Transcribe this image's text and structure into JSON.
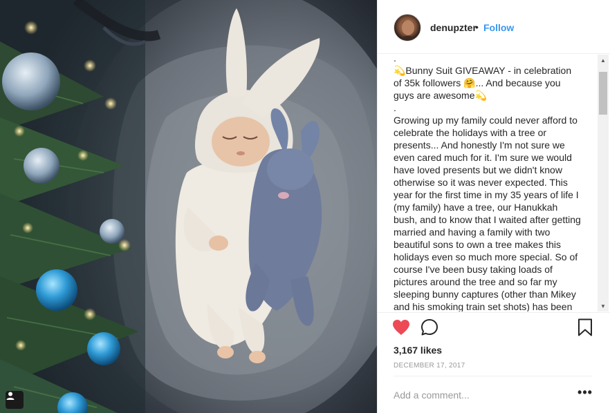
{
  "post": {
    "username": "denupzter",
    "separator": "•",
    "follow_label": "Follow",
    "caption": ".\n💫Bunny Suit GIVEAWAY - in celebration of 35k followers 🤗... And because you guys are awesome💫\n.\nGrowing up my family could never afford to celebrate the holidays with a tree or presents... And honestly I'm not sure we even cared much for it. I'm sure we would have loved presents but we didn't know otherwise so it was never expected. This year for the first time in my 35 years of life I (my family) have a tree, our Hanukkah bush, and to know that I waited after getting married and having a family with two beautiful sons to own a tree makes this holidays even so much more special. So of course I've been busy taking loads of pictures around the tree and so far my sleeping bunny captures (other than Mikey and his smoking train set shots) has been my favorite. That being said... I'm",
    "likes": "3,167 likes",
    "date": "December 17, 2017",
    "comment_placeholder": "Add a comment...",
    "more_label": "•••"
  },
  "icons": {
    "like": "heart-icon",
    "comment": "comment-bubble-icon",
    "save": "bookmark-icon",
    "tag": "user-tag-icon"
  },
  "colors": {
    "accent": "#3897f0",
    "like": "#ed4956",
    "text": "#262626",
    "muted": "#999999"
  }
}
